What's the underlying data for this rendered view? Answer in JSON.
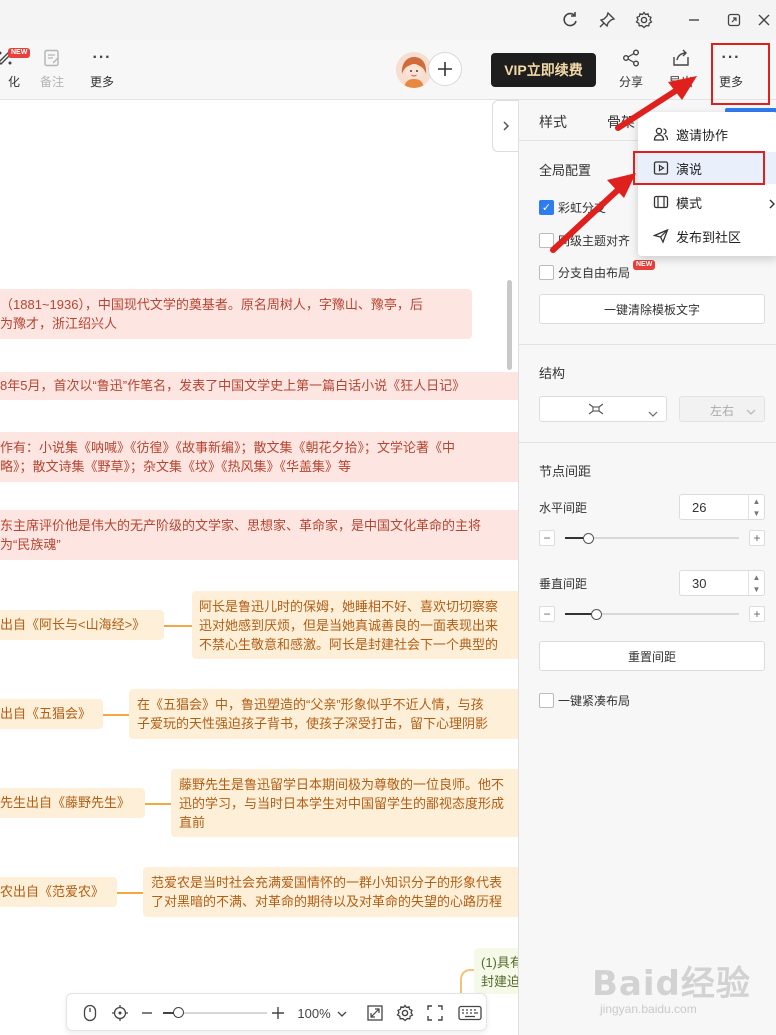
{
  "window": {
    "buttons": [
      "refresh",
      "pin",
      "settings",
      "minimize",
      "restore",
      "close"
    ]
  },
  "toolbar": {
    "partial_label": "化",
    "note_label": "备注",
    "more_label": "更多",
    "new_badge": "NEW",
    "vip_label": "VIP立即续费",
    "share_label": "分享",
    "export_label": "导出",
    "more2_label": "更多"
  },
  "canvas": {
    "red_nodes": [
      {
        "line1": "（1881~1936），中国现代文学的奠基者。原名周树人，字豫山、豫亭，后",
        "line2": "为豫才，浙江绍兴人"
      },
      {
        "line1": "8年5月，首次以“鲁迅”作笔名，发表了中国文学史上第一篇白话小说《狂人日记》",
        "line2": ""
      },
      {
        "line1": "作有：小说集《呐喊》《彷徨》《故事新编》；散文集《朝花夕拾》；文学论著《中",
        "line2": "略》；散文诗集《野草》；杂文集《坟》《热风集》《华盖集》等"
      },
      {
        "line1": "东主席评价他是伟大的无产阶级的文学家、思想家、革命家，是中国文化革命的主将",
        "line2": "为“民族魂”"
      }
    ],
    "orange_rows": [
      {
        "left": "出自《阿长与<山海经>》",
        "right1": "阿长是鲁迅儿时的保姆，她睡相不好、喜欢切切察察",
        "right2": "迅对她感到厌烦，但是当她真诚善良的一面表现出来",
        "right3": "不禁心生敬意和感激。阿长是封建社会下一个典型的"
      },
      {
        "left": "出自《五猖会》",
        "right1": "在《五猖会》中，鲁迅塑造的“父亲”形象似乎不近人情，与孩",
        "right2": "子爱玩的天性强迫孩子背书，使孩子深受打击，留下心理阴影",
        "right3": ""
      },
      {
        "left": "先生出自《藤野先生》",
        "right1": "藤野先生是鲁迅留学日本期间极为尊敬的一位良师。他不",
        "right2": "迅的学习，与当时日本学生对中国留学生的鄙视态度形成",
        "right3": "直前"
      },
      {
        "left": "农出自《范爱农》",
        "right1": "范爱农是当时社会充满爱国情怀的一群小知识分子的形象代表",
        "right2": "了对黑暗的不满、对革命的期待以及对革命的失望的心路历程",
        "right3": ""
      }
    ],
    "bottom_node": {
      "line1": "(1)具有",
      "line2": "封建迫"
    }
  },
  "bottombar": {
    "zoom": "100%"
  },
  "panel": {
    "tabs": [
      "样式",
      "骨架"
    ],
    "global_title": "全局配置",
    "rainbow_label": "彩虹分支",
    "align_label": "同级主题对齐",
    "free_layout_label": "分支自由布局",
    "free_badge": "NEW",
    "clear_btn": "一键清除模板文字",
    "structure_title": "结构",
    "direction_value": "左右",
    "spacing_title": "节点间距",
    "h_label": "水平间距",
    "h_value": "26",
    "h_level": 0.13,
    "v_label": "垂直间距",
    "v_value": "30",
    "v_level": 0.18,
    "reset_btn": "重置间距",
    "compact_label": "一键紧凑布局"
  },
  "menu": {
    "items": [
      {
        "label": "邀请协作",
        "icon": "users-icon"
      },
      {
        "label": "演说",
        "icon": "presentation-icon"
      },
      {
        "label": "模式",
        "icon": "mode-icon"
      },
      {
        "label": "发布到社区",
        "icon": "send-icon"
      }
    ]
  },
  "watermark": {
    "main": "Baid经验",
    "sub": "jingyan.baidu.com"
  },
  "colors": {
    "accent": "#2f7bf2",
    "highlight": "#e0201c",
    "node_red_bg": "#fde6e2",
    "node_orange_bg": "#fdefd8"
  }
}
